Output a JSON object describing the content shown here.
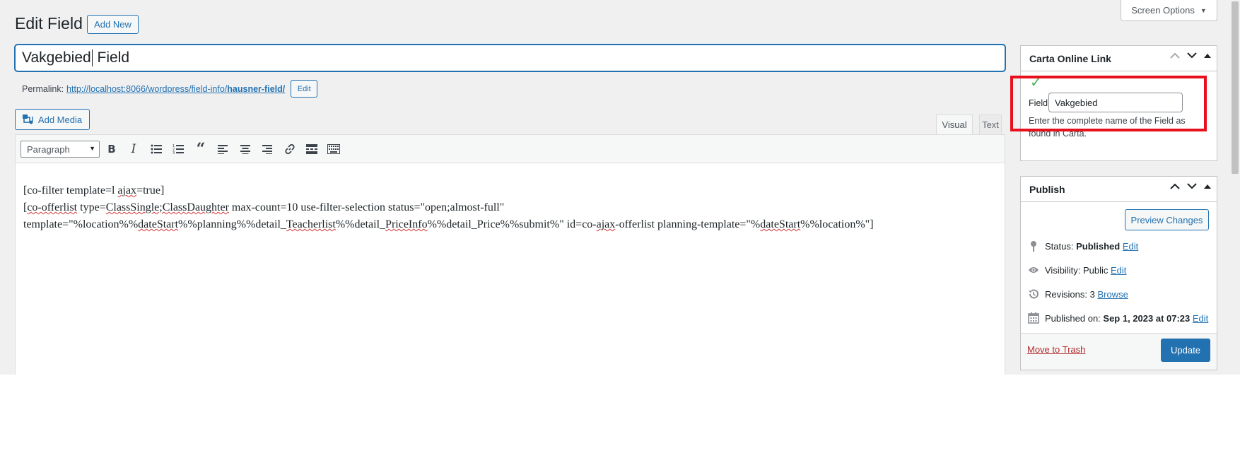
{
  "header": {
    "page_title": "Edit Field",
    "add_new_label": "Add New",
    "screen_options_label": "Screen Options"
  },
  "title_field": {
    "value_before_cursor": "Vakgebied",
    "value_after_cursor": " Field"
  },
  "permalink": {
    "label": "Permalink:",
    "url_base": "http://localhost:8066/wordpress/field-info/",
    "url_slug": "hausner-field/",
    "edit_label": "Edit"
  },
  "editor": {
    "add_media_label": "Add Media",
    "tab_visual": "Visual",
    "tab_text": "Text",
    "format_select": "Paragraph",
    "toolbar_icons": [
      "bold-icon",
      "italic-icon",
      "bullet-list-icon",
      "numbered-list-icon",
      "blockquote-icon",
      "align-left-icon",
      "align-center-icon",
      "align-right-icon",
      "link-icon",
      "read-more-icon",
      "toolbar-toggle-icon"
    ],
    "content": {
      "line1": "[co-filter template=l ajax=true]",
      "line2": "[co-offerlist type=ClassSingle;ClassDaughter max-count=10 use-filter-selection status=\"open;almost-full\"",
      "line3": "template=\"%location%%dateStart%%planning%%detail_Teacherlist%%detail_PriceInfo%%detail_Price%%submit%\" id=co-ajax-offerlist planning-template=\"%dateStart%%location%\"]"
    }
  },
  "carta_box": {
    "title": "Carta Online Link",
    "field_label": "Field",
    "field_value": "Vakgebied",
    "help_text": "Enter the complete name of the Field as found in Carta.",
    "highlight_color": "#e8101c"
  },
  "publish_box": {
    "title": "Publish",
    "preview_label": "Preview Changes",
    "status_label": "Status:",
    "status_value": "Published",
    "status_edit": "Edit",
    "visibility_label": "Visibility:",
    "visibility_value": "Public",
    "visibility_edit": "Edit",
    "revisions_label": "Revisions:",
    "revisions_value": "3",
    "revisions_browse": "Browse",
    "published_label": "Published on:",
    "published_value": "Sep 1, 2023 at 07:23",
    "published_edit": "Edit",
    "trash_label": "Move to Trash",
    "update_label": "Update",
    "accent_color": "#2271b1"
  }
}
